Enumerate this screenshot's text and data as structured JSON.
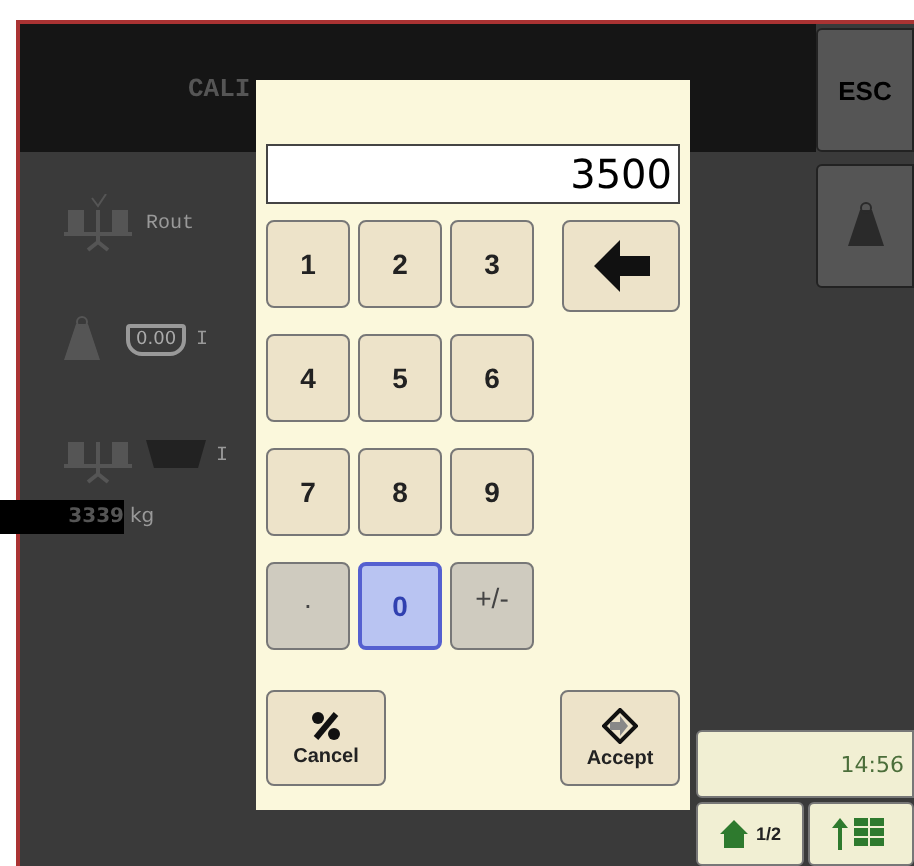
{
  "screen": {
    "title": "CALI",
    "rows": [
      {
        "kind": "scale",
        "label": "Rout"
      },
      {
        "kind": "display",
        "display": "0.00",
        "label": "I"
      },
      {
        "kind": "hopper",
        "label": "I"
      }
    ],
    "readout": {
      "value": "3339",
      "unit": "kg"
    },
    "side_buttons": [
      {
        "kind": "text",
        "label": "ESC"
      },
      {
        "kind": "weight"
      }
    ],
    "clock": "14:56",
    "nav": [
      {
        "kind": "home",
        "label": "1/2"
      },
      {
        "kind": "grid"
      }
    ]
  },
  "keypad": {
    "value": "3500",
    "keys": [
      {
        "label": "1",
        "selected": false,
        "disabled": false
      },
      {
        "label": "2",
        "selected": false,
        "disabled": false
      },
      {
        "label": "3",
        "selected": false,
        "disabled": false
      },
      {
        "label": "4",
        "selected": false,
        "disabled": false
      },
      {
        "label": "5",
        "selected": false,
        "disabled": false
      },
      {
        "label": "6",
        "selected": false,
        "disabled": false
      },
      {
        "label": "7",
        "selected": false,
        "disabled": false
      },
      {
        "label": "8",
        "selected": false,
        "disabled": false
      },
      {
        "label": "9",
        "selected": false,
        "disabled": false
      },
      {
        "label": ".",
        "selected": false,
        "disabled": true
      },
      {
        "label": "0",
        "selected": true,
        "disabled": false
      },
      {
        "label": "+/-",
        "selected": false,
        "disabled": true
      }
    ],
    "cancel": "Cancel",
    "accept": "Accept"
  }
}
